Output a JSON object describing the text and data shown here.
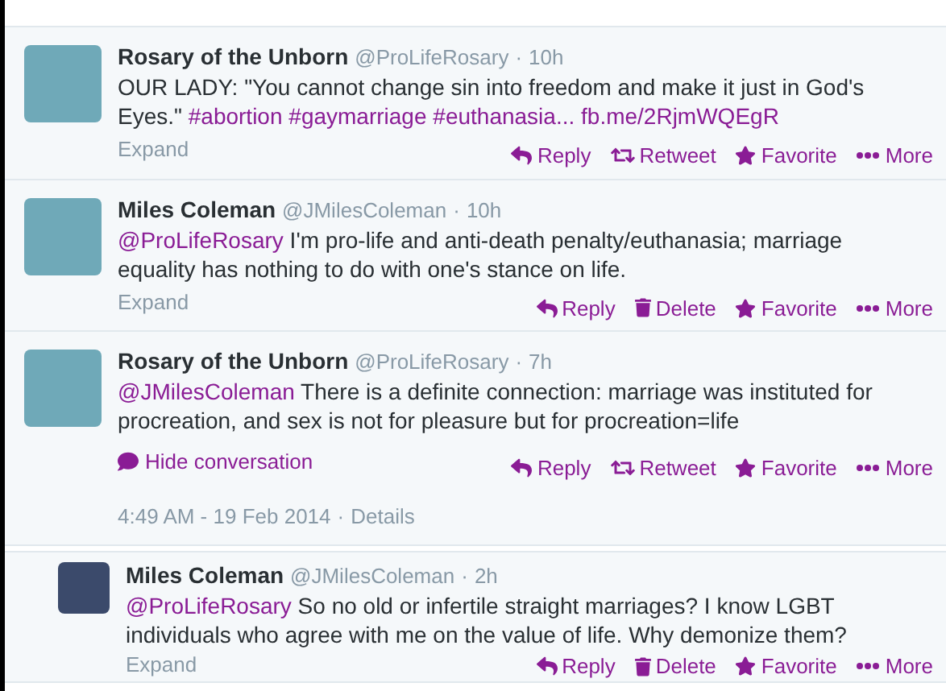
{
  "tweets": [
    {
      "name": "Rosary of the Unborn",
      "handle": "@ProLifeRosary",
      "separator": "·",
      "time": "10h",
      "reply": false,
      "body": [
        {
          "kind": "text",
          "text": "OUR LADY: \"You cannot change sin into freedom and make it just in God's Eyes.\" "
        },
        {
          "kind": "link",
          "text": "#abortion"
        },
        {
          "kind": "link",
          "text": "#gaymarriage"
        },
        {
          "kind": "link",
          "text": "#euthanasia..."
        },
        {
          "kind": "link",
          "text": "fb.me/2RjmWQEgR"
        }
      ],
      "toggle": {
        "kind": "expand",
        "label": "Expand"
      },
      "actions": [
        {
          "kind": "reply",
          "label": "Reply"
        },
        {
          "kind": "retweet",
          "label": "Retweet"
        },
        {
          "kind": "favorite",
          "label": "Favorite"
        },
        {
          "kind": "more",
          "label": "More"
        }
      ]
    },
    {
      "name": "Miles Coleman",
      "handle": "@JMilesColeman",
      "separator": "·",
      "time": "10h",
      "reply": false,
      "body": [
        {
          "kind": "link",
          "text": "@ProLifeRosary"
        },
        {
          "kind": "text",
          "text": " I'm pro-life and anti-death penalty/euthanasia; marriage equality has nothing to do with one's stance on life."
        }
      ],
      "toggle": {
        "kind": "expand",
        "label": "Expand"
      },
      "actions": [
        {
          "kind": "reply",
          "label": "Reply"
        },
        {
          "kind": "delete",
          "label": "Delete"
        },
        {
          "kind": "favorite",
          "label": "Favorite"
        },
        {
          "kind": "more",
          "label": "More"
        }
      ]
    },
    {
      "name": "Rosary of the Unborn",
      "handle": "@ProLifeRosary",
      "separator": "·",
      "time": "7h",
      "reply": false,
      "body": [
        {
          "kind": "link",
          "text": "@JMilesColeman"
        },
        {
          "kind": "text",
          "text": " There is a definite connection: marriage was instituted for procreation, and sex is not for pleasure but for procreation=life"
        }
      ],
      "toggle": {
        "kind": "hide",
        "label": "Hide conversation"
      },
      "actions": [
        {
          "kind": "reply",
          "label": "Reply"
        },
        {
          "kind": "retweet",
          "label": "Retweet"
        },
        {
          "kind": "favorite",
          "label": "Favorite"
        },
        {
          "kind": "more",
          "label": "More"
        }
      ],
      "timestamp": "4:49 AM - 19 Feb 2014",
      "details_separator": "·",
      "details": "Details"
    },
    {
      "name": "Miles Coleman",
      "handle": "@JMilesColeman",
      "separator": "·",
      "time": "2h",
      "reply": true,
      "body": [
        {
          "kind": "link",
          "text": "@ProLifeRosary"
        },
        {
          "kind": "text",
          "text": " So no old or infertile straight marriages? I know LGBT individuals who agree with me on the value of life. Why demonize them?"
        }
      ],
      "toggle": {
        "kind": "expand",
        "label": "Expand"
      },
      "actions": [
        {
          "kind": "reply",
          "label": "Reply"
        },
        {
          "kind": "delete",
          "label": "Delete"
        },
        {
          "kind": "favorite",
          "label": "Favorite"
        },
        {
          "kind": "more",
          "label": "More"
        }
      ]
    }
  ]
}
